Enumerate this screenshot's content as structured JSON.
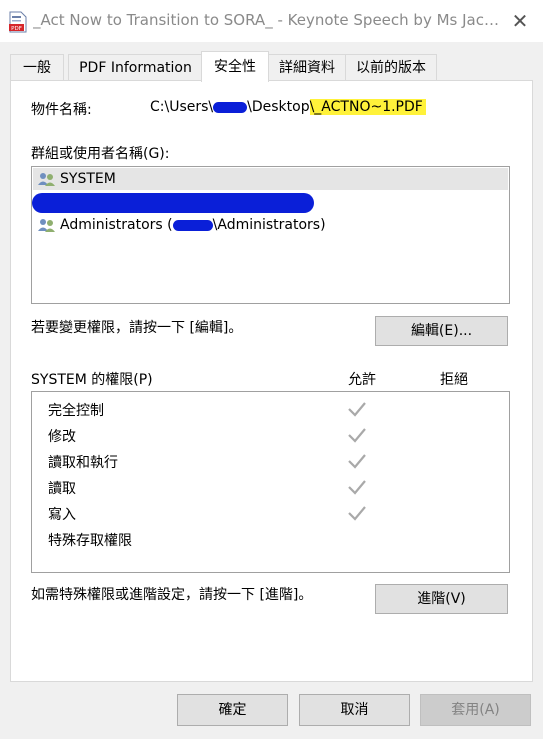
{
  "window": {
    "title": "_Act Now to Transition to SORA_ - Keynote Speech by Ms Jacquel...",
    "close_label": "✕"
  },
  "tabs": [
    {
      "label": "一般",
      "active": false
    },
    {
      "label": "PDF Information",
      "active": false
    },
    {
      "label": "安全性",
      "active": true
    },
    {
      "label": "詳細資料",
      "active": false
    },
    {
      "label": "以前的版本",
      "active": false
    }
  ],
  "object_name": {
    "label": "物件名稱:",
    "path_prefix": "C:\\Users\\",
    "path_middle": "\\Desktop",
    "path_highlighted": "\\_ACTNO~1.PDF"
  },
  "groups": {
    "label": "群組或使用者名稱(G):",
    "items": [
      {
        "name": "SYSTEM",
        "icon": "user-group-icon",
        "selected": true
      },
      {
        "name": "",
        "icon": "user-group-icon",
        "redacted": true
      },
      {
        "name_prefix": "Administrators (",
        "name_suffix": "\\Administrators)",
        "icon": "user-group-icon"
      }
    ]
  },
  "edit": {
    "hint": "若要變更權限，請按一下 [編輯]。",
    "button_label": "編輯(E)..."
  },
  "permissions": {
    "title": "SYSTEM 的權限(P)",
    "allow_header": "允許",
    "deny_header": "拒絕",
    "rows": [
      {
        "name": "完全控制",
        "allow": true,
        "deny": false
      },
      {
        "name": "修改",
        "allow": true,
        "deny": false
      },
      {
        "name": "讀取和執行",
        "allow": true,
        "deny": false
      },
      {
        "name": "讀取",
        "allow": true,
        "deny": false
      },
      {
        "name": "寫入",
        "allow": true,
        "deny": false
      },
      {
        "name": "特殊存取權限",
        "allow": false,
        "deny": false
      }
    ]
  },
  "advanced": {
    "hint": "如需特殊權限或進階設定，請按一下 [進階]。",
    "button_label": "進階(V)"
  },
  "footer": {
    "ok_label": "確定",
    "cancel_label": "取消",
    "apply_label": "套用(A)"
  },
  "colors": {
    "highlight": "#fff23a",
    "redaction": "#0a1fd8",
    "check": "#a9a9a9"
  }
}
